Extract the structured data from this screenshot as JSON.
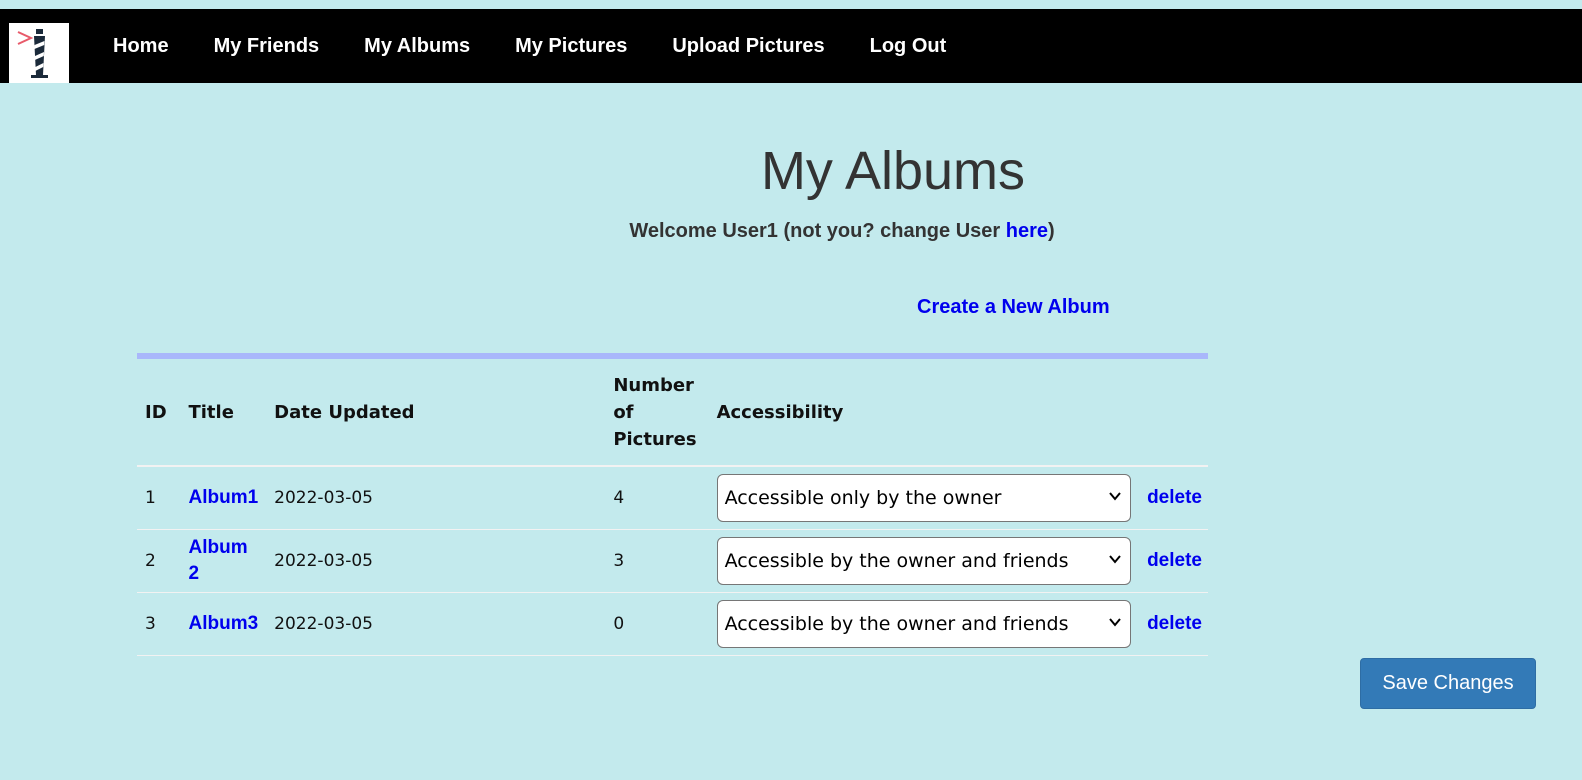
{
  "nav": {
    "items": [
      {
        "label": "Home"
      },
      {
        "label": "My Friends"
      },
      {
        "label": "My Albums"
      },
      {
        "label": "My Pictures"
      },
      {
        "label": "Upload Pictures"
      },
      {
        "label": "Log Out"
      }
    ],
    "background": "#000000",
    "logo_icon": "lighthouse-icon"
  },
  "page": {
    "title": "My Albums",
    "welcome_prefix": "Welcome User1 (not you? change User ",
    "welcome_link": "here",
    "welcome_suffix": ")",
    "create_link": "Create a New Album",
    "background": "#c3eaed",
    "link_color": "#0000ee"
  },
  "table": {
    "headers": {
      "id": "ID",
      "title": "Title",
      "date": "Date Updated",
      "count_line1": "Number",
      "count_line2": "of",
      "count_line3": "Pictures",
      "accessibility": "Accessibility"
    },
    "rows": [
      {
        "id": "1",
        "title": "Album1",
        "date": "2022-03-05",
        "count": "4",
        "accessibility": "Accessible only by the owner",
        "delete": "delete"
      },
      {
        "id": "2",
        "title": "Album 2",
        "date": "2022-03-05",
        "count": "3",
        "accessibility": "Accessible by the owner and friends",
        "delete": "delete"
      },
      {
        "id": "3",
        "title": "Album3",
        "date": "2022-03-05",
        "count": "0",
        "accessibility": "Accessible by the owner and friends",
        "delete": "delete"
      }
    ],
    "top_border_color": "#a9b7fb"
  },
  "save_button": {
    "label": "Save Changes",
    "color": "#337ab7"
  }
}
